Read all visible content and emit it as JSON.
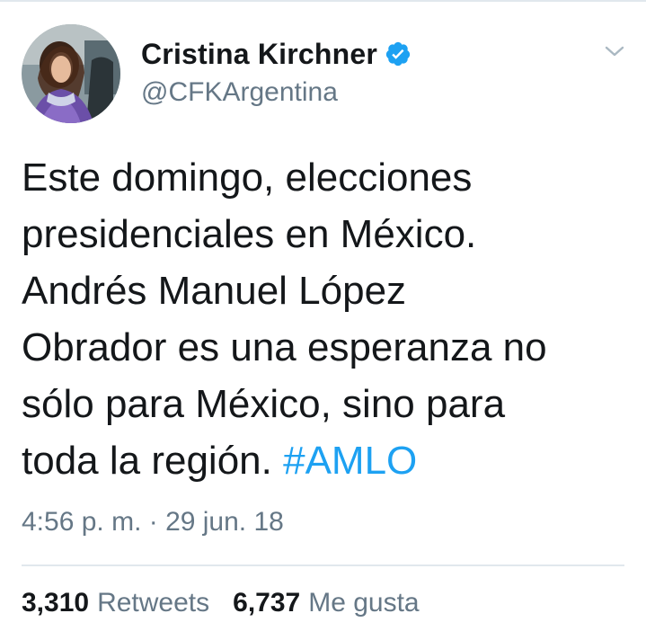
{
  "tweet": {
    "author": {
      "display_name": "Cristina Kirchner",
      "handle": "@CFKArgentina",
      "verified": true,
      "verified_icon": "verified-badge-icon",
      "avatar_icon": "profile-photo"
    },
    "menu_icon": "chevron-down-icon",
    "text_lines": [
      "Este domingo, elecciones",
      "presidenciales en México.",
      "Andrés Manuel López",
      "Obrador es una esperanza no",
      "sólo para México, sino para",
      "toda la región."
    ],
    "hashtag": "#AMLO",
    "timestamp": "4:56 p. m. · 29 jun. 18",
    "stats": {
      "retweets_count": "3,310",
      "retweets_label": "Retweets",
      "likes_count": "6,737",
      "likes_label": "Me gusta"
    }
  },
  "colors": {
    "text": "#14171a",
    "secondary": "#657786",
    "accent": "#1da1f2",
    "divider": "#e1e8ed"
  }
}
